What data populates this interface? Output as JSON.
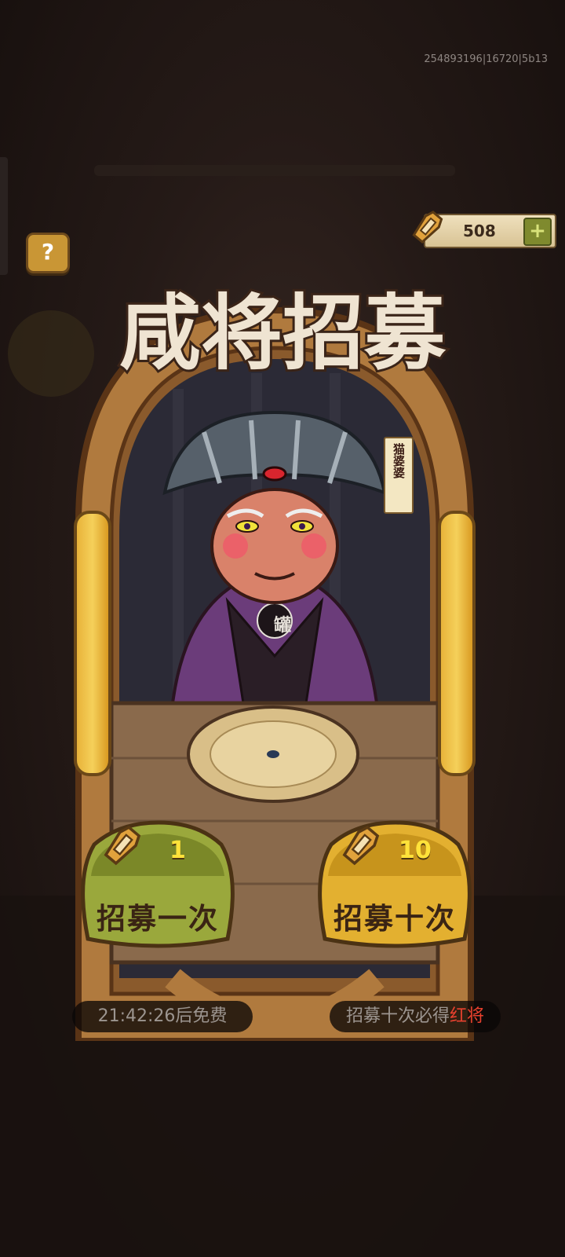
{
  "build_id": "254893196|16720|5b13",
  "help": {
    "label": "?"
  },
  "currency": {
    "amount": "508",
    "plus_label": "+",
    "icon": "coffin-key-icon"
  },
  "banner": {
    "title": "咸将招募"
  },
  "character": {
    "name": "猫婆婆",
    "badge": "罐"
  },
  "buttons": {
    "once": {
      "cost": "1",
      "label": "招募一次",
      "color": "#9aa83c"
    },
    "ten": {
      "cost": "10",
      "label": "招募十次",
      "color": "#e3b030"
    }
  },
  "timer": {
    "text": "21:42:26后免费"
  },
  "guarantee": {
    "prefix": "招募十次必得",
    "highlight": "红将",
    "highlight_color": "#e8412e"
  }
}
